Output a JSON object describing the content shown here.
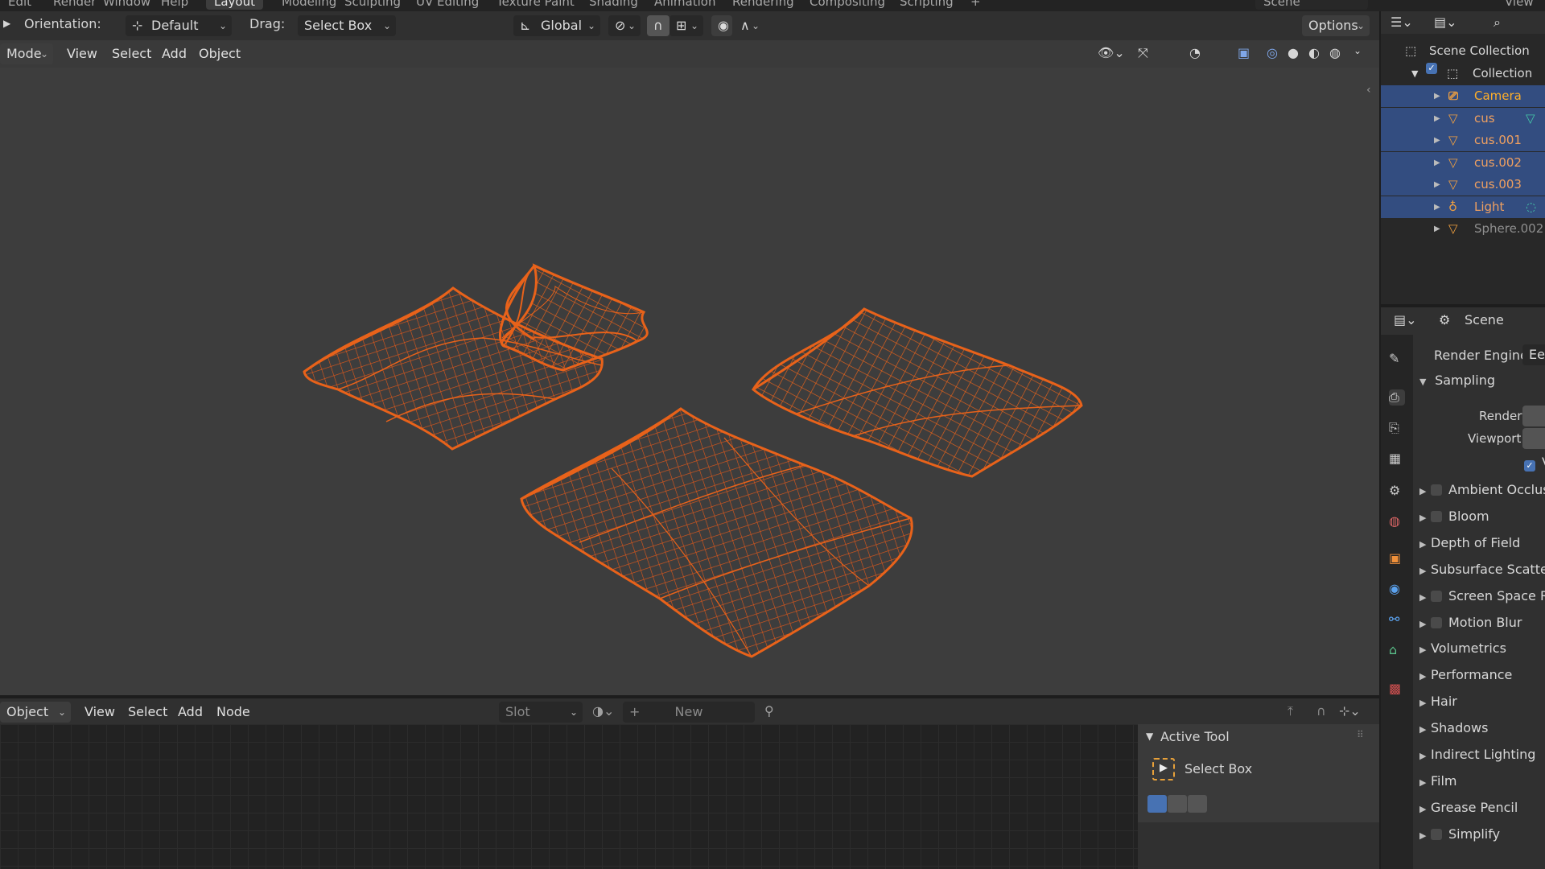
{
  "workspace_tabs": [
    "Layout",
    "Modeling",
    "Sculpting",
    "UV Editing",
    "Texture Paint",
    "Shading",
    "Animation",
    "Rendering",
    "Compositing",
    "Scripting",
    "+"
  ],
  "top_menus": [
    "Edit",
    "Render",
    "Window",
    "Help"
  ],
  "scene_name": "Scene",
  "view_layer": "View",
  "tool_header": {
    "orientation_label": "Orientation:",
    "orientation_value": "Default",
    "drag_label": "Drag:",
    "drag_value": "Select Box",
    "transform_orientation": "Global",
    "options_label": "Options"
  },
  "viewport_header": {
    "mode": "Mode",
    "menus": [
      "View",
      "Select",
      "Add",
      "Object"
    ]
  },
  "outliner": {
    "scene_collection": "Scene Collection",
    "collection": "Collection",
    "items": [
      {
        "name": "Camera",
        "type": "camera",
        "selected": true,
        "active": true
      },
      {
        "name": "cus",
        "type": "mesh",
        "selected": true
      },
      {
        "name": "cus.001",
        "type": "mesh",
        "selected": true
      },
      {
        "name": "cus.002",
        "type": "mesh",
        "selected": true
      },
      {
        "name": "cus.003",
        "type": "mesh",
        "selected": true
      },
      {
        "name": "Light",
        "type": "light",
        "selected": true
      },
      {
        "name": "Sphere.002",
        "type": "mesh",
        "selected": false
      }
    ]
  },
  "properties": {
    "context": "Scene",
    "render_engine_label": "Render Engine",
    "render_engine_value": "Ee",
    "sampling_label": "Sampling",
    "render_label": "Render",
    "viewport_label": "Viewport",
    "viewport_denoise_cut": "V",
    "panels": [
      {
        "label": "Ambient Occlus",
        "checkbox": true
      },
      {
        "label": "Bloom",
        "checkbox": true
      },
      {
        "label": "Depth of Field",
        "checkbox": false
      },
      {
        "label": "Subsurface Scatte",
        "checkbox": false
      },
      {
        "label": "Screen Space R",
        "checkbox": true
      },
      {
        "label": "Motion Blur",
        "checkbox": true
      },
      {
        "label": "Volumetrics",
        "checkbox": false
      },
      {
        "label": "Performance",
        "checkbox": false
      },
      {
        "label": "Hair",
        "checkbox": false
      },
      {
        "label": "Shadows",
        "checkbox": false
      },
      {
        "label": "Indirect Lighting",
        "checkbox": false
      },
      {
        "label": "Film",
        "checkbox": false
      },
      {
        "label": "Grease Pencil",
        "checkbox": false
      },
      {
        "label": "Simplify",
        "checkbox": true
      }
    ]
  },
  "node_editor": {
    "mode": "Object",
    "menus": [
      "View",
      "Select",
      "Add",
      "Node"
    ],
    "slot_label": "Slot",
    "new_label": "New"
  },
  "active_tool": {
    "header": "Active Tool",
    "tool_name": "Select Box"
  },
  "colors": {
    "wire": "#e8621a",
    "selection": "#334d80",
    "active_text": "#ffaf29",
    "selected_text": "#f0a060"
  }
}
